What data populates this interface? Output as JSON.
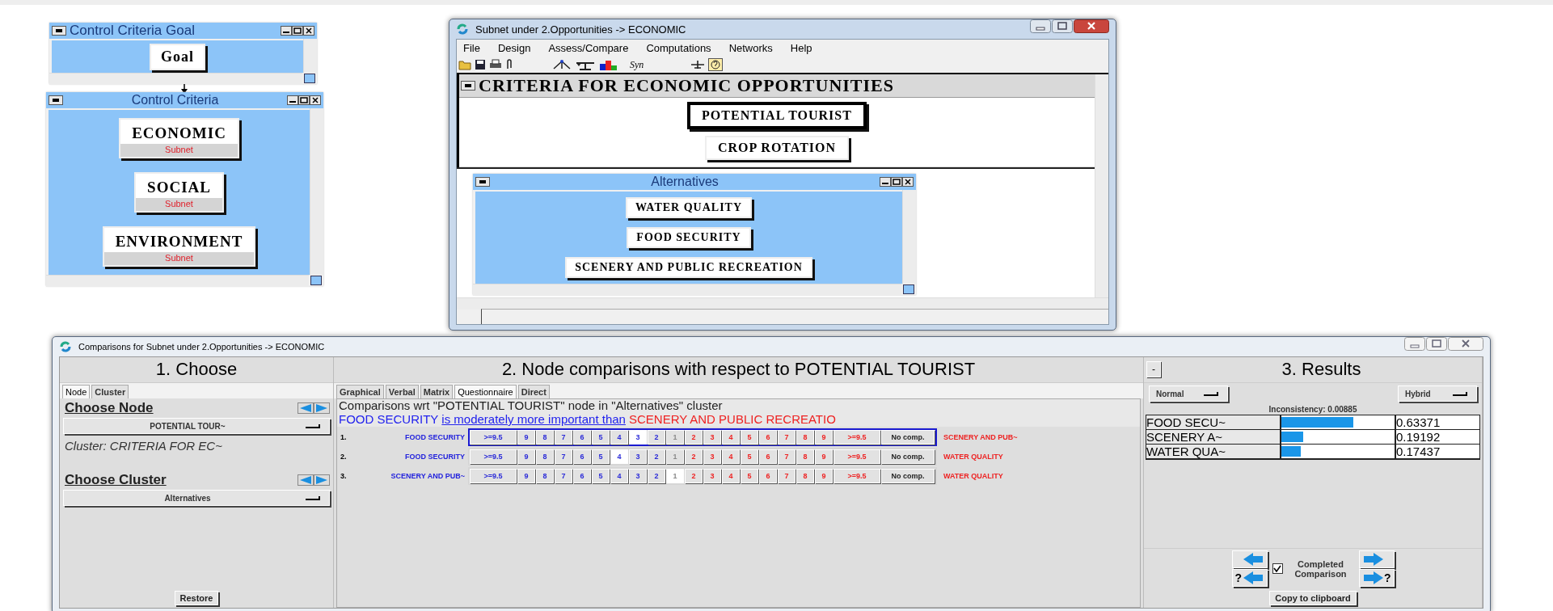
{
  "control_goal_window": {
    "title": "Control Criteria Goal",
    "nodes": [
      {
        "label": "Goal"
      }
    ]
  },
  "control_criteria_window": {
    "title": "Control Criteria",
    "nodes": [
      {
        "label": "ECONOMIC",
        "sublabel": "Subnet"
      },
      {
        "label": "SOCIAL",
        "sublabel": "Subnet"
      },
      {
        "label": "ENVIRONMENT",
        "sublabel": "Subnet"
      }
    ]
  },
  "subnet_window": {
    "title": "Subnet under 2.Opportunities -> ECONOMIC",
    "menu": [
      "File",
      "Design",
      "Assess/Compare",
      "Computations",
      "Networks",
      "Help"
    ],
    "toolbar_text": "Syn",
    "criteria_cluster": {
      "title": "CRITERIA FOR ECONOMIC OPPORTUNITIES",
      "nodes": [
        {
          "label": "POTENTIAL TOURIST",
          "selected": true
        },
        {
          "label": "CROP ROTATION",
          "selected": false
        }
      ]
    },
    "alternatives_cluster": {
      "title": "Alternatives",
      "nodes": [
        {
          "label": "WATER QUALITY"
        },
        {
          "label": "FOOD SECURITY"
        },
        {
          "label": "SCENERY AND PUBLIC RECREATION"
        }
      ]
    }
  },
  "comparisons_window": {
    "title": "Comparisons for Subnet under 2.Opportunities -> ECONOMIC",
    "choose": {
      "heading": "1. Choose",
      "tabs": [
        {
          "label": "Node",
          "selected": true
        },
        {
          "label": "Cluster",
          "selected": false
        }
      ],
      "node_heading": "Choose Node",
      "node_dropdown": "POTENTIAL TOUR~",
      "cluster_note": "Cluster: CRITERIA FOR EC~",
      "cluster_heading": "Choose Cluster",
      "cluster_dropdown": "Alternatives",
      "restore_button": "Restore"
    },
    "comparisons": {
      "heading": "2. Node comparisons with respect to POTENTIAL TOURIST",
      "tabs": [
        {
          "label": "Graphical",
          "selected": false
        },
        {
          "label": "Verbal",
          "selected": false
        },
        {
          "label": "Matrix",
          "selected": false
        },
        {
          "label": "Questionnaire",
          "selected": true
        },
        {
          "label": "Direct",
          "selected": false
        }
      ],
      "caption": "Comparisons wrt \"POTENTIAL TOURIST\" node in \"Alternatives\" cluster",
      "verdict": {
        "left": "FOOD SECURITY",
        "middle": "is moderately more important than",
        "right": "SCENERY AND PUBLIC RECREATIO"
      },
      "rows": [
        {
          "number": "1.",
          "left": "FOOD SECURITY",
          "right": "SCENERY AND PUB~",
          "active": true,
          "no_comp": "No comp.",
          "cells": [
            {
              "label": ">=9.5",
              "kind": "left",
              "selected": false
            },
            {
              "label": "9",
              "kind": "left",
              "selected": false
            },
            {
              "label": "8",
              "kind": "left",
              "selected": false
            },
            {
              "label": "7",
              "kind": "left",
              "selected": false
            },
            {
              "label": "6",
              "kind": "left",
              "selected": false
            },
            {
              "label": "5",
              "kind": "left",
              "selected": false
            },
            {
              "label": "4",
              "kind": "left",
              "selected": false
            },
            {
              "label": "3",
              "kind": "left",
              "selected": true
            },
            {
              "label": "2",
              "kind": "left",
              "selected": false
            },
            {
              "label": "1",
              "kind": "equal",
              "selected": false
            },
            {
              "label": "2",
              "kind": "right",
              "selected": false
            },
            {
              "label": "3",
              "kind": "right",
              "selected": false
            },
            {
              "label": "4",
              "kind": "right",
              "selected": false
            },
            {
              "label": "5",
              "kind": "right",
              "selected": false
            },
            {
              "label": "6",
              "kind": "right",
              "selected": false
            },
            {
              "label": "7",
              "kind": "right",
              "selected": false
            },
            {
              "label": "8",
              "kind": "right",
              "selected": false
            },
            {
              "label": "9",
              "kind": "right",
              "selected": false
            },
            {
              "label": ">=9.5",
              "kind": "right",
              "selected": false
            }
          ]
        },
        {
          "number": "2.",
          "left": "FOOD SECURITY",
          "right": "WATER QUALITY",
          "active": false,
          "no_comp": "No comp.",
          "cells": [
            {
              "label": ">=9.5",
              "kind": "left",
              "selected": false
            },
            {
              "label": "9",
              "kind": "left",
              "selected": false
            },
            {
              "label": "8",
              "kind": "left",
              "selected": false
            },
            {
              "label": "7",
              "kind": "left",
              "selected": false
            },
            {
              "label": "6",
              "kind": "left",
              "selected": false
            },
            {
              "label": "5",
              "kind": "left",
              "selected": false
            },
            {
              "label": "4",
              "kind": "left",
              "selected": true
            },
            {
              "label": "3",
              "kind": "left",
              "selected": false
            },
            {
              "label": "2",
              "kind": "left",
              "selected": false
            },
            {
              "label": "1",
              "kind": "equal",
              "selected": false
            },
            {
              "label": "2",
              "kind": "right",
              "selected": false
            },
            {
              "label": "3",
              "kind": "right",
              "selected": false
            },
            {
              "label": "4",
              "kind": "right",
              "selected": false
            },
            {
              "label": "5",
              "kind": "right",
              "selected": false
            },
            {
              "label": "6",
              "kind": "right",
              "selected": false
            },
            {
              "label": "7",
              "kind": "right",
              "selected": false
            },
            {
              "label": "8",
              "kind": "right",
              "selected": false
            },
            {
              "label": "9",
              "kind": "right",
              "selected": false
            },
            {
              "label": ">=9.5",
              "kind": "right",
              "selected": false
            }
          ]
        },
        {
          "number": "3.",
          "left": "SCENERY AND PUB~",
          "right": "WATER QUALITY",
          "active": false,
          "no_comp": "No comp.",
          "cells": [
            {
              "label": ">=9.5",
              "kind": "left",
              "selected": false
            },
            {
              "label": "9",
              "kind": "left",
              "selected": false
            },
            {
              "label": "8",
              "kind": "left",
              "selected": false
            },
            {
              "label": "7",
              "kind": "left",
              "selected": false
            },
            {
              "label": "6",
              "kind": "left",
              "selected": false
            },
            {
              "label": "5",
              "kind": "left",
              "selected": false
            },
            {
              "label": "4",
              "kind": "left",
              "selected": false
            },
            {
              "label": "3",
              "kind": "left",
              "selected": false
            },
            {
              "label": "2",
              "kind": "left",
              "selected": false
            },
            {
              "label": "1",
              "kind": "equal",
              "selected": true
            },
            {
              "label": "2",
              "kind": "right",
              "selected": false
            },
            {
              "label": "3",
              "kind": "right",
              "selected": false
            },
            {
              "label": "4",
              "kind": "right",
              "selected": false
            },
            {
              "label": "5",
              "kind": "right",
              "selected": false
            },
            {
              "label": "6",
              "kind": "right",
              "selected": false
            },
            {
              "label": "7",
              "kind": "right",
              "selected": false
            },
            {
              "label": "8",
              "kind": "right",
              "selected": false
            },
            {
              "label": "9",
              "kind": "right",
              "selected": false
            },
            {
              "label": ">=9.5",
              "kind": "right",
              "selected": false
            }
          ]
        }
      ]
    },
    "results": {
      "collapse_button": "-",
      "heading": "3. Results",
      "mode_dropdown": "Normal",
      "method_dropdown": "Hybrid",
      "inconsistency": "Inconsistency: 0.00885",
      "rows": [
        {
          "name": "FOOD SECU~",
          "level": 0.63371,
          "value": "0.63371"
        },
        {
          "name": "SCENERY A~",
          "level": 0.19192,
          "value": "0.19192"
        },
        {
          "name": "WATER QUA~",
          "level": 0.17437,
          "value": "0.17437"
        }
      ],
      "back_help_mark": "?",
      "forward_help_mark": "?",
      "completed": {
        "label": "Completed Comparison",
        "checked": true
      },
      "copy_button": "Copy to clipboard"
    }
  }
}
